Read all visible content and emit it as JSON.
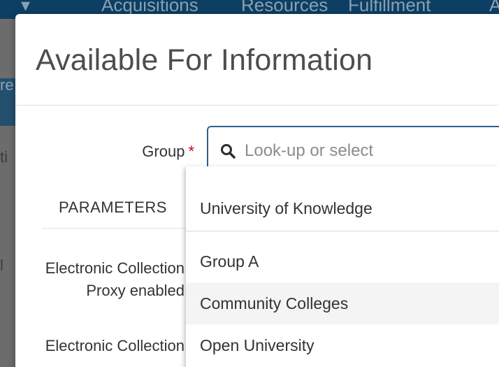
{
  "background": {
    "nav_items": [
      "Acquisitions",
      "Resources",
      "Fulfillment",
      "A"
    ],
    "left_fragments": [
      "re",
      "ti",
      "l"
    ]
  },
  "modal": {
    "title": "Available For Information",
    "group_label": "Group",
    "required_marker": "*",
    "search": {
      "placeholder": "Look-up or select",
      "value": ""
    },
    "parameters_header": "PARAMETERS",
    "parameters": [
      {
        "label": "Electronic Collection Proxy enabled"
      },
      {
        "label": "Electronic Collection"
      }
    ]
  },
  "dropdown": {
    "options": [
      {
        "label": "University of Knowledge",
        "highlighted": false
      },
      {
        "label": "Group A",
        "highlighted": false
      },
      {
        "label": "Community Colleges",
        "highlighted": true
      },
      {
        "label": "Open University",
        "highlighted": false
      }
    ]
  }
}
